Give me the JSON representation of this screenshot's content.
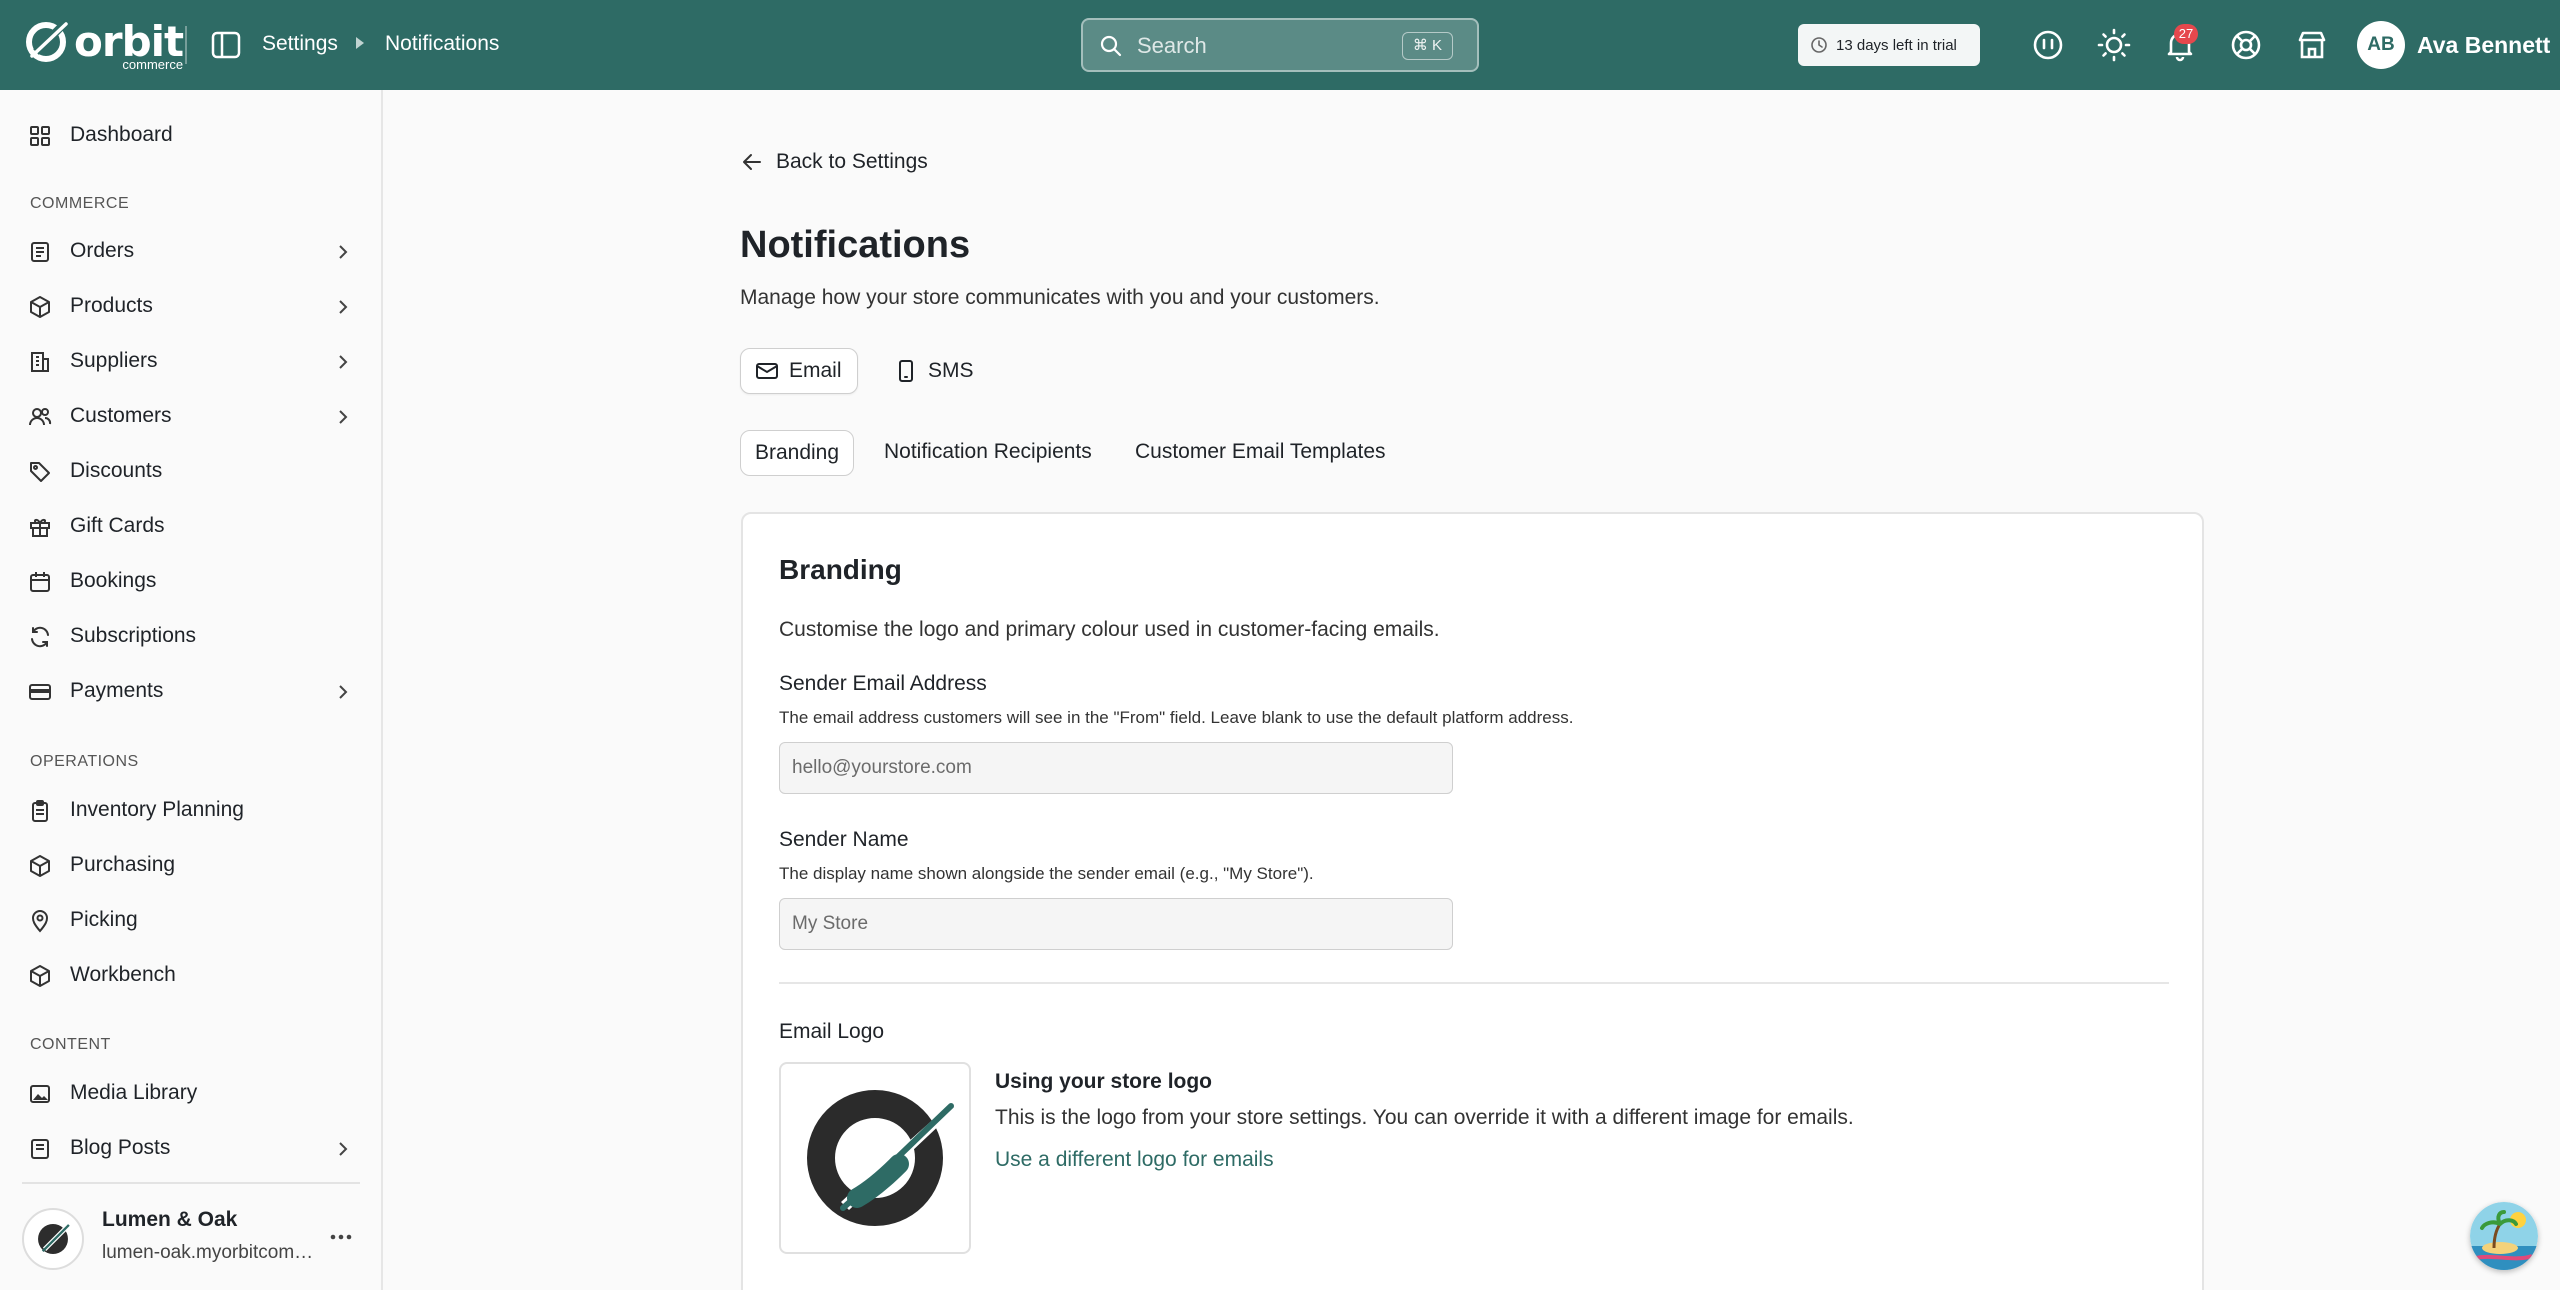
{
  "brand": {
    "name": "orbit",
    "sub": "commerce",
    "primary_color": "#2e6b65"
  },
  "breadcrumb": {
    "parent": "Settings",
    "current": "Notifications"
  },
  "search": {
    "placeholder": "Search",
    "shortcut": "⌘ K"
  },
  "trial": {
    "text": "13 days left in trial"
  },
  "header_icons": [
    "feedback-icon",
    "sun-icon",
    "bell-icon",
    "help-icon",
    "store-icon"
  ],
  "notifications": {
    "count": "27"
  },
  "user": {
    "initials": "AB",
    "name": "Ava Bennett"
  },
  "sidebar": {
    "top": [
      {
        "label": "Dashboard",
        "icon": "dashboard-icon"
      }
    ],
    "sections": [
      {
        "label": "COMMERCE",
        "items": [
          {
            "label": "Orders",
            "icon": "orders-icon",
            "chevron": true
          },
          {
            "label": "Products",
            "icon": "box-icon",
            "chevron": true
          },
          {
            "label": "Suppliers",
            "icon": "building-icon",
            "chevron": true
          },
          {
            "label": "Customers",
            "icon": "users-icon",
            "chevron": true
          },
          {
            "label": "Discounts",
            "icon": "tag-icon",
            "chevron": false
          },
          {
            "label": "Gift Cards",
            "icon": "gift-icon",
            "chevron": false
          },
          {
            "label": "Bookings",
            "icon": "calendar-icon",
            "chevron": false
          },
          {
            "label": "Subscriptions",
            "icon": "refresh-icon",
            "chevron": false
          },
          {
            "label": "Payments",
            "icon": "card-icon",
            "chevron": true
          }
        ]
      },
      {
        "label": "OPERATIONS",
        "items": [
          {
            "label": "Inventory Planning",
            "icon": "clipboard-icon",
            "chevron": false
          },
          {
            "label": "Purchasing",
            "icon": "box-icon",
            "chevron": false
          },
          {
            "label": "Picking",
            "icon": "pin-icon",
            "chevron": false
          },
          {
            "label": "Workbench",
            "icon": "box-icon",
            "chevron": false
          }
        ]
      },
      {
        "label": "CONTENT",
        "items": [
          {
            "label": "Media Library",
            "icon": "image-icon",
            "chevron": false
          },
          {
            "label": "Blog Posts",
            "icon": "document-icon",
            "chevron": true
          }
        ]
      }
    ],
    "store": {
      "name": "Lumen & Oak",
      "url": "lumen-oak.myorbitcommerce.com"
    }
  },
  "page": {
    "back_label": "Back to Settings",
    "title": "Notifications",
    "subtitle": "Manage how your store communicates with you and your customers.",
    "channels": [
      {
        "label": "Email",
        "active": true,
        "icon": "mail-icon"
      },
      {
        "label": "SMS",
        "active": false,
        "icon": "phone-icon"
      }
    ],
    "tabs": [
      {
        "label": "Branding",
        "active": true
      },
      {
        "label": "Notification Recipients",
        "active": false
      },
      {
        "label": "Customer Email Templates",
        "active": false
      }
    ]
  },
  "branding": {
    "title": "Branding",
    "subtitle": "Customise the logo and primary colour used in customer-facing emails.",
    "sender_email": {
      "label": "Sender Email Address",
      "help": "The email address customers will see in the \"From\" field. Leave blank to use the default platform address.",
      "placeholder": "hello@yourstore.com",
      "value": ""
    },
    "sender_name": {
      "label": "Sender Name",
      "help": "The display name shown alongside the sender email (e.g., \"My Store\").",
      "placeholder": "My Store",
      "value": ""
    },
    "email_logo": {
      "label": "Email Logo",
      "title": "Using your store logo",
      "description": "This is the logo from your store settings. You can override it with a different image for emails.",
      "link": "Use a different logo for emails"
    }
  }
}
